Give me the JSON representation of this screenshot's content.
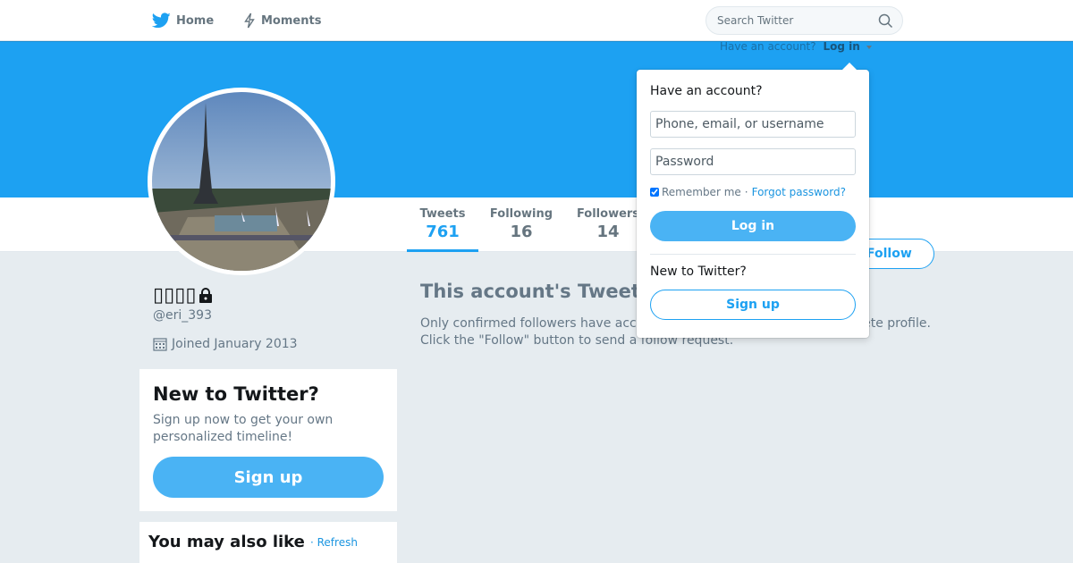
{
  "nav": {
    "home_label": "Home",
    "moments_label": "Moments",
    "search_placeholder": "Search Twitter"
  },
  "header": {
    "have_account": "Have an account?",
    "login_label": "Log in"
  },
  "stats": [
    {
      "label": "Tweets",
      "value": "761"
    },
    {
      "label": "Following",
      "value": "16"
    },
    {
      "label": "Followers",
      "value": "14"
    }
  ],
  "profile": {
    "display_name": "▯▯▯▯",
    "handle": "@eri_393",
    "joined": "Joined January 2013",
    "follow_label": "Follow"
  },
  "signup_card": {
    "title": "New to Twitter?",
    "text": "Sign up now to get your own personalized timeline!",
    "button": "Sign up"
  },
  "wtf": {
    "title": "You may also like",
    "refresh": "· Refresh"
  },
  "protected": {
    "title": "This account's Tweets are protected.",
    "body": "Only confirmed followers have access to @eri_393's Tweets and complete profile. Click the \"Follow\" button to send a follow request."
  },
  "login_dropdown": {
    "title": "Have an account?",
    "username_placeholder": "Phone, email, or username",
    "password_placeholder": "Password",
    "remember": "Remember me",
    "separator": "·",
    "forgot": "Forgot password?",
    "login_button": "Log in",
    "new_title": "New to Twitter?",
    "signup_button": "Sign up"
  },
  "colors": {
    "brand": "#1da1f2",
    "button": "#4ab3f4",
    "background": "#e6ecf0"
  }
}
